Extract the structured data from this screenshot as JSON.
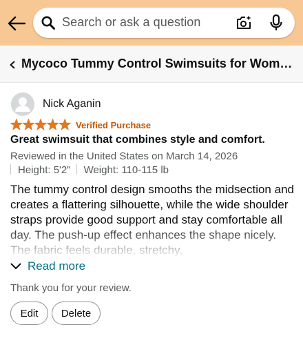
{
  "search": {
    "placeholder": "Search or ask a question",
    "icons": [
      "back-arrow-icon",
      "search-icon",
      "camera-icon",
      "mic-icon"
    ]
  },
  "header": {
    "background": "#f7c894",
    "product_title": "Mycoco Tummy Control Swimsuits for Wome..."
  },
  "review": {
    "reviewer_name": "Nick Aganin",
    "rating": 5,
    "rating_max": 5,
    "star_color": "#de7921",
    "verified_label": "Verified Purchase",
    "title": "Great swimsuit that combines style and comfort.",
    "meta": "Reviewed in the United States on March 14, 2026",
    "attributes": [
      "Height: 5'2\"",
      "Weight: 110-115 lb"
    ],
    "body": "The tummy control design smooths the midsection and creates a flattering silhouette, while the wide shoulder straps provide good support and stay comfortable all day. The push-up effect enhances the shape nicely. The fabric feels durable, stretchy,",
    "read_more_label": "Read more",
    "link_color": "#007185"
  },
  "footer": {
    "thanks_text": "Thank you for your review.",
    "edit_label": "Edit",
    "delete_label": "Delete"
  }
}
